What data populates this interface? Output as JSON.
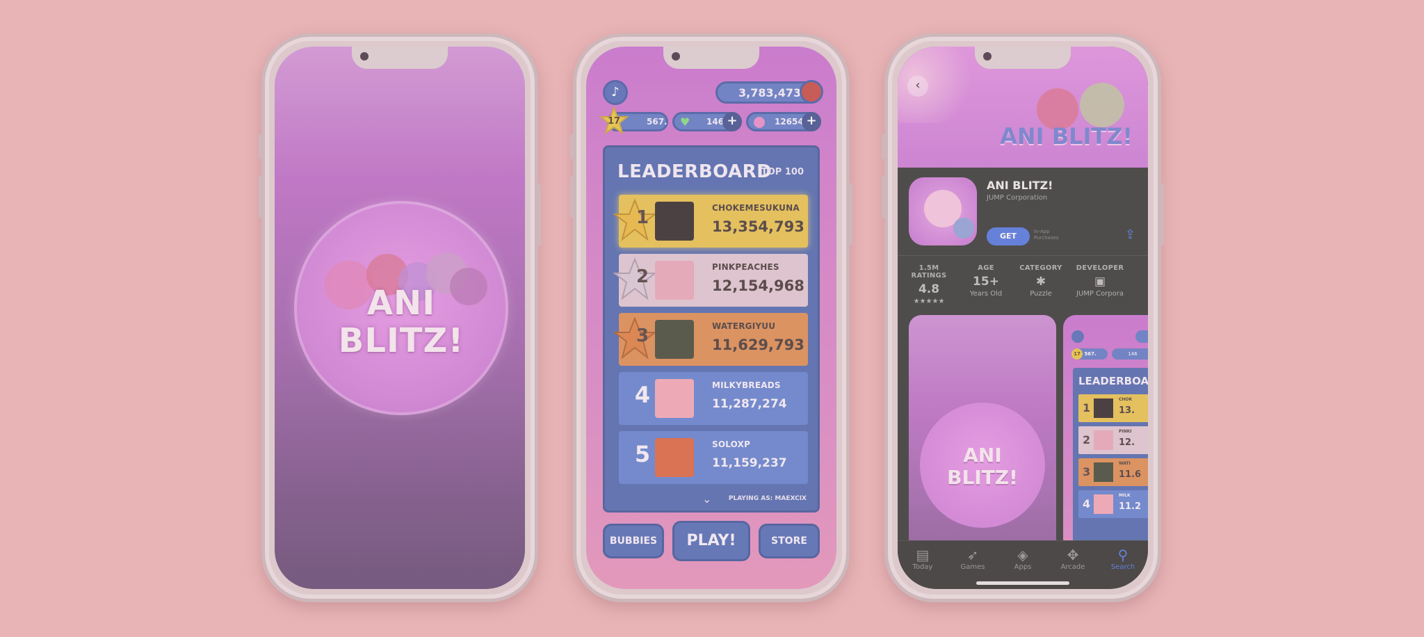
{
  "splash": {
    "title_line1": "ANI",
    "title_line2": "BLITZ!"
  },
  "game": {
    "coins": "3,783,473",
    "level": "17",
    "xp_percent": "567.",
    "gems": "146",
    "bubbles": "126548",
    "leaderboard": {
      "title": "LEADERBOARD",
      "filter": "TOP 100",
      "rows": [
        {
          "rank": "1",
          "name": "CHOKEMESUKUNA",
          "score": "13,354,793"
        },
        {
          "rank": "2",
          "name": "PINKPEACHES",
          "score": "12,154,968"
        },
        {
          "rank": "3",
          "name": "WATERGIYUU",
          "score": "11,629,793"
        },
        {
          "rank": "4",
          "name": "MILKYBREADS",
          "score": "11,287,274"
        },
        {
          "rank": "5",
          "name": "SOLOXP",
          "score": "11,159,237"
        }
      ],
      "playing_as": "PLAYING AS: MAEXCIX"
    },
    "buttons": {
      "bubbies": "BUBBIES",
      "play": "PLAY!",
      "store": "STORE"
    },
    "colors": {
      "gold": "#e5c14a",
      "silver": "#dcc6d2",
      "bronze": "#d98a4d",
      "blue_row": "#5c7fcf"
    }
  },
  "store": {
    "header_logo": "ANI BLITZ!",
    "app_name": "ANI BLITZ!",
    "developer": "JUMP Corporation",
    "get_label": "GET",
    "in_app": "In-App\nPurchases",
    "stats": [
      {
        "label": "1.5M RATINGS",
        "value": "4.8",
        "sub": "★★★★★"
      },
      {
        "label": "AGE",
        "value": "15+",
        "sub": "Years Old"
      },
      {
        "label": "CATEGORY",
        "value": "✱",
        "sub": "Puzzle"
      },
      {
        "label": "DEVELOPER",
        "value": "▣",
        "sub": "JUMP Corpora"
      }
    ],
    "preview1": {
      "title_line1": "ANI",
      "title_line2": "BLITZ!"
    },
    "preview2": {
      "title": "LEADERBOARD",
      "level": "17",
      "xp": "567.",
      "gems": "146",
      "rows": [
        {
          "rank": "1",
          "name": "CHOK",
          "score": "13."
        },
        {
          "rank": "2",
          "name": "PINKI",
          "score": "12."
        },
        {
          "rank": "3",
          "name": "WATI",
          "score": "11.6"
        },
        {
          "rank": "4",
          "name": "MILK",
          "score": "11.2"
        }
      ]
    },
    "tabs": [
      "Today",
      "Games",
      "Apps",
      "Arcade",
      "Search"
    ]
  }
}
